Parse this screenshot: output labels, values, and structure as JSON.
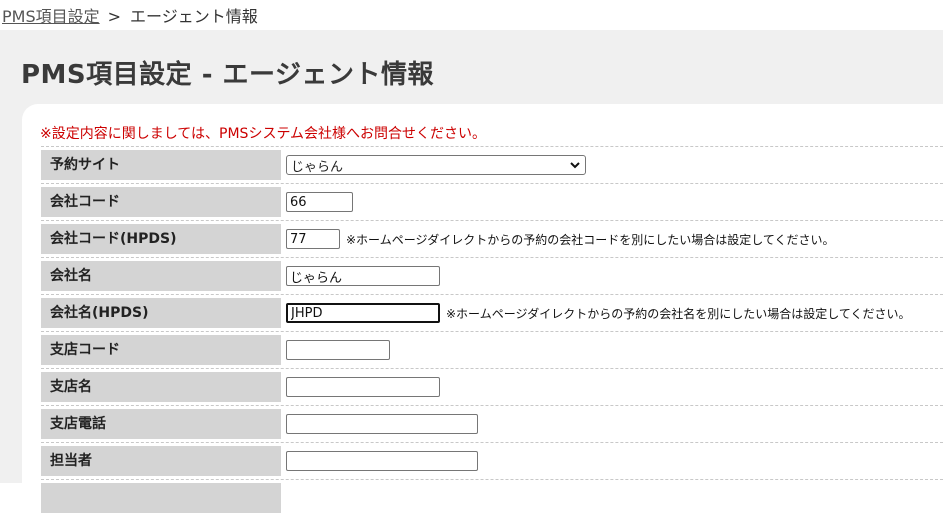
{
  "breadcrumb": {
    "link": "PMS項目設定",
    "separator": ">",
    "current": "エージェント情報"
  },
  "page": {
    "title": "PMS項目設定 - エージェント情報"
  },
  "notice": "※設定内容に関しましては、PMSシステム会社様へお問合せください。",
  "fields": {
    "reservation_site": {
      "label": "予約サイト",
      "value": "じゃらん"
    },
    "company_code": {
      "label": "会社コード",
      "value": "66"
    },
    "company_code_hpds": {
      "label": "会社コード(HPDS)",
      "value": "77",
      "note": "※ホームページダイレクトからの予約の会社コードを別にしたい場合は設定してください。"
    },
    "company_name": {
      "label": "会社名",
      "value": "じゃらん"
    },
    "company_name_hpds": {
      "label": "会社名(HPDS)",
      "value": "JHPD",
      "note": "※ホームページダイレクトからの予約の会社名を別にしたい場合は設定してください。"
    },
    "branch_code": {
      "label": "支店コード",
      "value": ""
    },
    "branch_name": {
      "label": "支店名",
      "value": ""
    },
    "branch_phone": {
      "label": "支店電話",
      "value": ""
    },
    "person_in_charge": {
      "label": "担当者",
      "value": ""
    }
  },
  "colors": {
    "notice": "#cc0000",
    "label_bg": "#d4d4d4",
    "page_bg": "#f0f0f0"
  },
  "icons": {
    "select_arrow": "chevron-down-icon"
  }
}
